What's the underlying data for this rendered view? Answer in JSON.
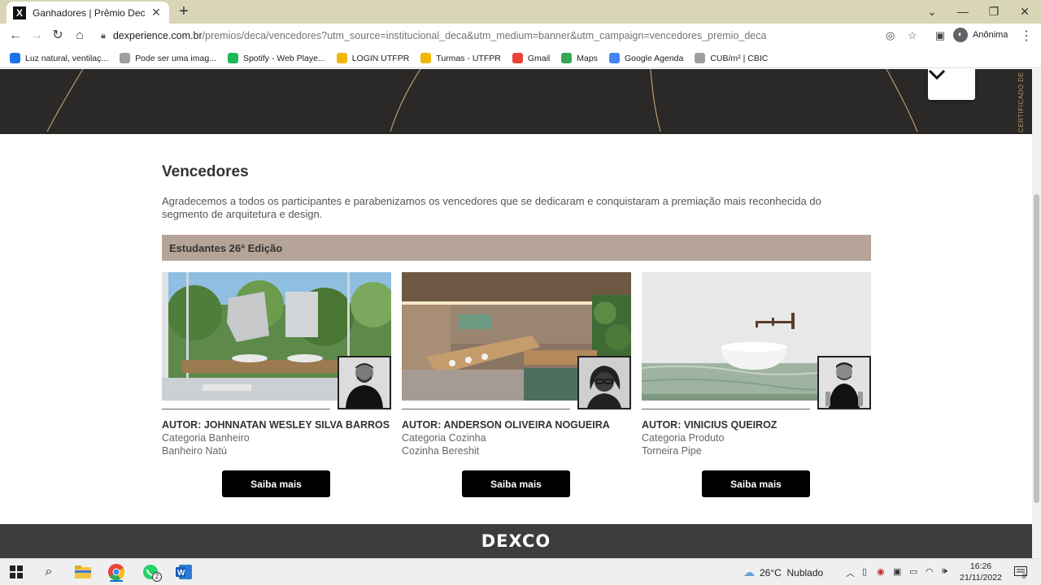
{
  "browser": {
    "tab_title": "Ganhadores | Prêmio Deca | DEXPERIENCE",
    "url_host": "dexperience.com.br",
    "url_path": "/premios/deca/vencedores?utm_source=institucional_deca&utm_medium=banner&utm_campaign=vencedores_premio_deca",
    "profile_label": "Anônima",
    "bookmarks": [
      {
        "label": "Luz natural, ventilaç...",
        "icon": "home-icon",
        "color": "#1a73e8"
      },
      {
        "label": "Pode ser uma imag...",
        "icon": "globe-icon",
        "color": "#9e9e9e"
      },
      {
        "label": "Spotify - Web Playe...",
        "icon": "spotify-icon",
        "color": "#1db954"
      },
      {
        "label": "LOGIN UTFPR",
        "icon": "utfpr-icon",
        "color": "#f2b705"
      },
      {
        "label": "Turmas - UTFPR",
        "icon": "utfpr-icon",
        "color": "#f2b705"
      },
      {
        "label": "Gmail",
        "icon": "gmail-icon",
        "color": "#ea4335"
      },
      {
        "label": "Maps",
        "icon": "maps-pin-icon",
        "color": "#34a853"
      },
      {
        "label": "Google Agenda",
        "icon": "calendar-icon",
        "color": "#4285f4"
      },
      {
        "label": "CUB/m² | CBIC",
        "icon": "globe-icon",
        "color": "#9e9e9e"
      }
    ]
  },
  "page": {
    "side_vertical_text": "CERTIFICADO DE A",
    "section_title": "Vencedores",
    "intro": "Agradecemos a todos os participantes e parabenizamos os vencedores que se dedicaram e conquistaram a premiação mais reconhecida do segmento de arquitetura e design.",
    "edition": "Estudantes 26ª Edição",
    "cards": [
      {
        "author": "AUTOR: JOHNNATAN WESLEY SILVA BARROS",
        "category": "Categoria Banheiro",
        "project": "Banheiro Natú",
        "button": "Saiba mais"
      },
      {
        "author": "AUTOR: ANDERSON OLIVEIRA NOGUEIRA",
        "category": "Categoria Cozinha",
        "project": "Cozinha Bereshit",
        "button": "Saiba mais"
      },
      {
        "author": "AUTOR: VINICIUS QUEIROZ",
        "category": "Categoria Produto",
        "project": "Torneira Pipe",
        "button": "Saiba mais"
      }
    ],
    "footer_logo": "DEXCO"
  },
  "taskbar": {
    "weather": "26°C  Nublado",
    "time": "16:26",
    "date": "21/11/2022",
    "whatsapp_badge": "2",
    "notification_count": "8"
  },
  "colors": {
    "hero_bg": "#2b2828",
    "hero_lines": "#b79a6c",
    "edition_bar": "#b7a498",
    "button_bg": "#000000",
    "footer_bg": "#3d3d3d"
  }
}
